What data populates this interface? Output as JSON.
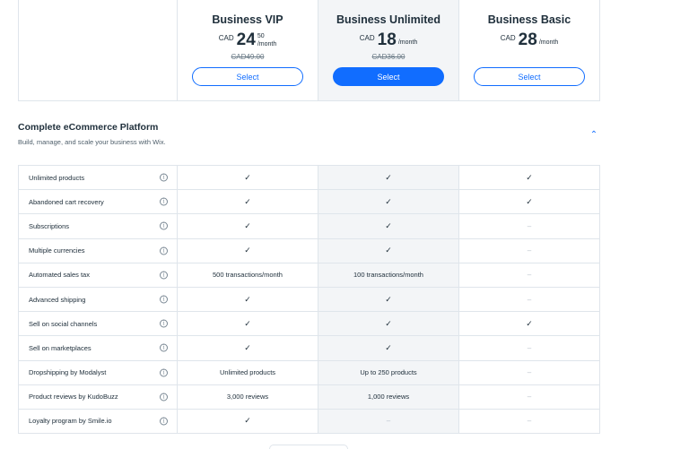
{
  "plans": [
    {
      "name": "Business VIP",
      "currency": "CAD",
      "amount": "24",
      "cents": "50",
      "period": "/month",
      "original": "CAD49.00",
      "select_label": "Select"
    },
    {
      "name": "Business Unlimited",
      "currency": "CAD",
      "amount": "18",
      "cents": "",
      "period": "/month",
      "original": "CAD36.00",
      "select_label": "Select"
    },
    {
      "name": "Business Basic",
      "currency": "CAD",
      "amount": "28",
      "cents": "",
      "period": "/month",
      "original": "",
      "select_label": "Select"
    }
  ],
  "section": {
    "title": "Complete eCommerce Platform",
    "subtitle": "Build, manage, and scale your business with Wix."
  },
  "features": [
    {
      "name": "Unlimited products",
      "values": [
        "check",
        "check",
        "check"
      ]
    },
    {
      "name": "Abandoned cart recovery",
      "values": [
        "check",
        "check",
        "check"
      ]
    },
    {
      "name": "Subscriptions",
      "values": [
        "check",
        "check",
        "dash"
      ]
    },
    {
      "name": "Multiple currencies",
      "values": [
        "check",
        "check",
        "dash"
      ]
    },
    {
      "name": "Automated sales tax",
      "values": [
        "500 transactions/month",
        "100 transactions/month",
        "dash"
      ]
    },
    {
      "name": "Advanced shipping",
      "values": [
        "check",
        "check",
        "dash"
      ]
    },
    {
      "name": "Sell on social channels",
      "values": [
        "check",
        "check",
        "check"
      ]
    },
    {
      "name": "Sell on marketplaces",
      "values": [
        "check",
        "check",
        "dash"
      ]
    },
    {
      "name": "Dropshipping by Modalyst",
      "values": [
        "Unlimited products",
        "Up to 250 products",
        "dash"
      ]
    },
    {
      "name": "Product reviews by KudoBuzz",
      "values": [
        "3,000 reviews",
        "1,000 reviews",
        "dash"
      ]
    },
    {
      "name": "Loyalty program by Smile.io",
      "values": [
        "check",
        "dash",
        "dash"
      ]
    }
  ],
  "glyphs": {
    "check": "✓",
    "dash": "–",
    "info": "i",
    "chevron": "⌃"
  },
  "colors": {
    "accent": "#116dff",
    "featured_bg": "#f3f5f7",
    "border": "#dfe5eb"
  }
}
